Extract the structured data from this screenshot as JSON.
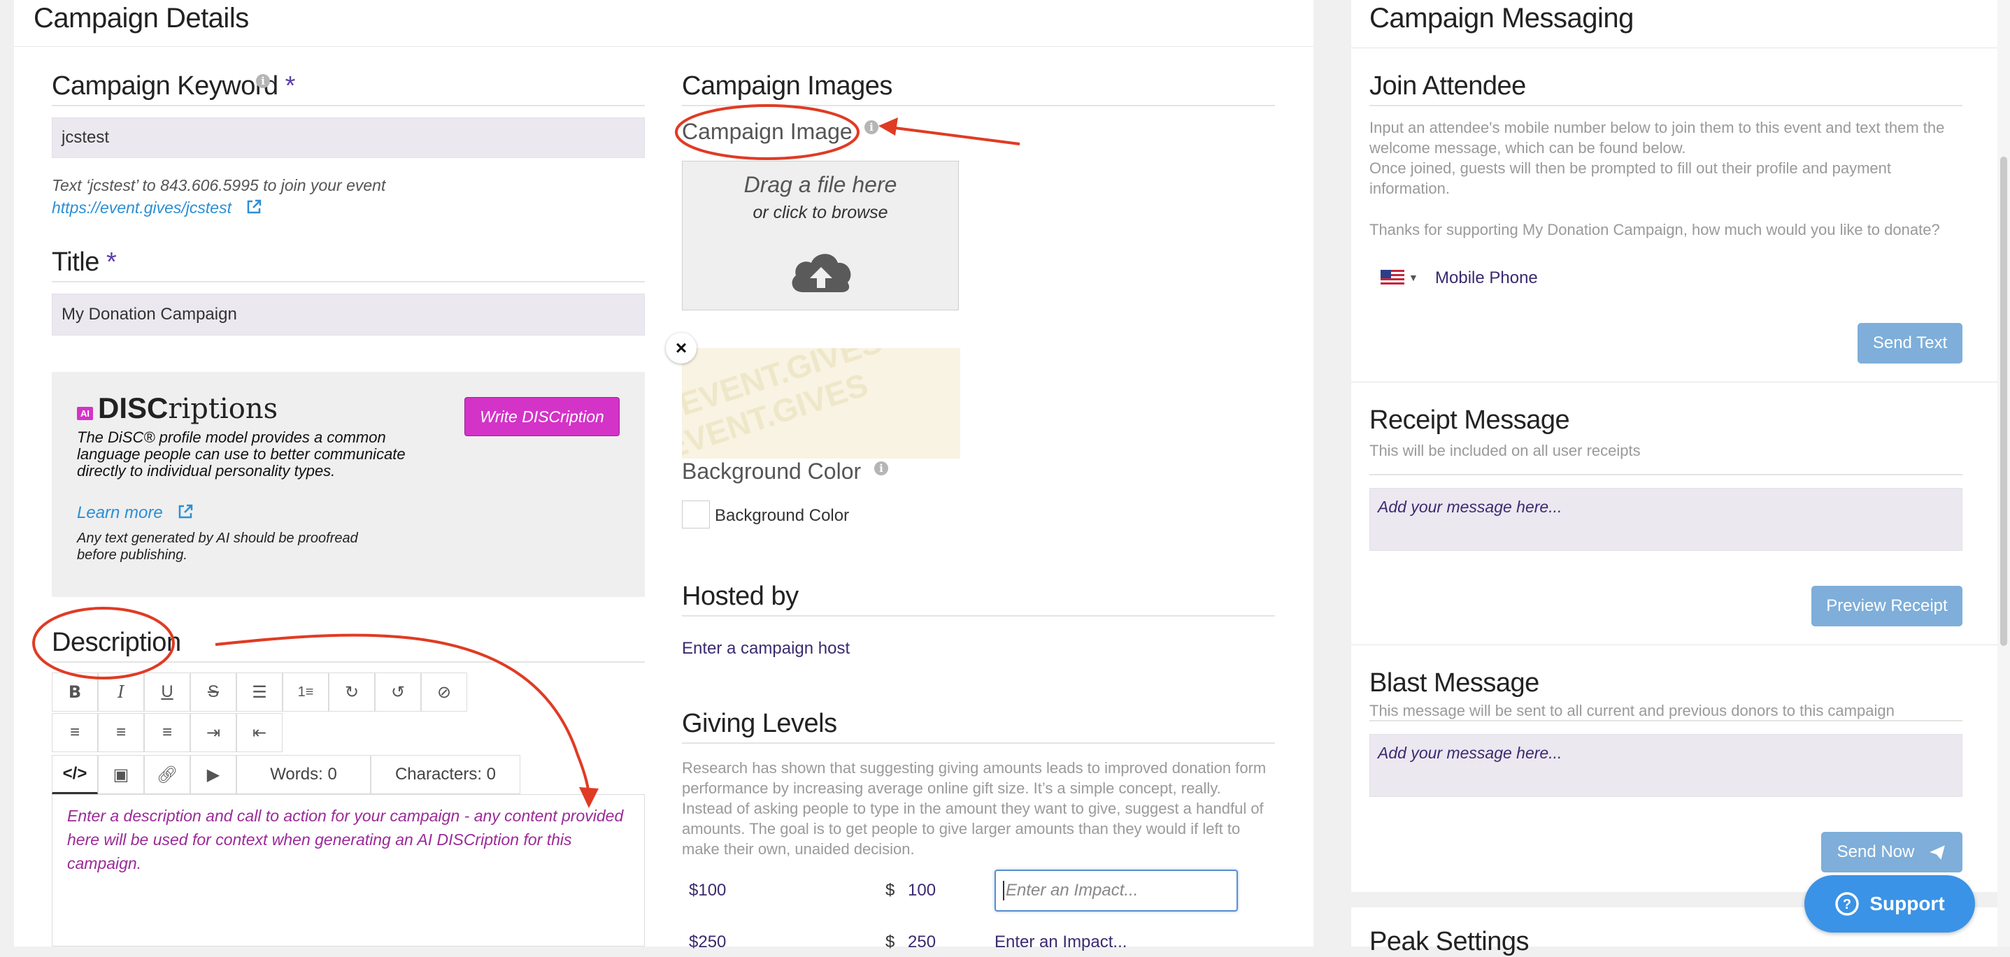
{
  "left_panel": {
    "title": "Campaign Details",
    "keyword": {
      "label": "Campaign Keyword",
      "required": "*",
      "value": "jcstest",
      "hint": "Text ‘jcstest’ to 843.606.5995 to join your event",
      "link": "https://event.gives/jcstest"
    },
    "title_field": {
      "label": "Title",
      "required": "*",
      "value": "My Donation Campaign"
    },
    "discriptions": {
      "ai_badge": "AI",
      "logo_bold": "DISC",
      "logo_light": "riptions",
      "description": "The DiSC® profile model provides a common language people can use to better communicate directly to individual personality types.",
      "learn_more": "Learn more",
      "disclaimer": "Any text generated by AI should be proofread before publishing.",
      "write_button": "Write DISCription"
    },
    "description": {
      "label": "Description",
      "words": "Words: 0",
      "characters": "Characters: 0",
      "placeholder": "Enter a description and call to action for your campaign - any content provided here will be used for context when generating an AI DISCription for this campaign.",
      "toolbar_icons": [
        "bold-icon",
        "italic-icon",
        "underline-icon",
        "strikethrough-icon",
        "bullet-list-icon",
        "numbered-list-icon",
        "redo-icon",
        "undo-icon",
        "clear-format-icon",
        "align-left-icon",
        "align-center-icon",
        "align-right-icon",
        "indent-icon",
        "outdent-icon",
        "code-view-icon",
        "image-icon",
        "link-icon",
        "video-icon"
      ]
    },
    "images": {
      "section": "Campaign Images",
      "image_label": "Campaign Image",
      "drop_line1": "Drag a file here",
      "drop_line2": "or click to browse",
      "watermark": "EVENT.GIVES",
      "bg_label": "Background Color",
      "bg_checkbox": "Background Color"
    },
    "hosted_by": {
      "section": "Hosted by",
      "placeholder": "Enter a campaign host"
    },
    "giving_levels": {
      "section": "Giving Levels",
      "description": "Research has shown that suggesting giving amounts leads to improved donation form performance by increasing average online gift size. It’s a simple concept, really. Instead of asking people to type in the amount they want to give, suggest a handful of amounts. The goal is to get people to give larger amounts than they would if left to make their own, unaided decision.",
      "levels": [
        {
          "label": "$100",
          "currency": "$",
          "amount": "100",
          "impact_placeholder": "Enter an Impact..."
        },
        {
          "label": "$250",
          "currency": "$",
          "amount": "250",
          "impact_placeholder": "Enter an Impact..."
        }
      ]
    }
  },
  "right_panel": {
    "title": "Campaign Messaging",
    "join": {
      "section": "Join Attendee",
      "text1": "Input an attendee's mobile number below to join them to this event and text them the welcome message, which can be found below.",
      "text2": "Once joined, guests will then be prompted to fill out their profile and payment information.",
      "text3": "Thanks for supporting My Donation Campaign, how much would you like to donate?",
      "phone_placeholder": "Mobile Phone",
      "send_button": "Send Text"
    },
    "receipt": {
      "section": "Receipt Message",
      "sub": "This will be included on all user receipts",
      "placeholder": "Add your message here...",
      "button": "Preview Receipt"
    },
    "blast": {
      "section": "Blast Message",
      "sub": "This message will be sent to all current and previous donors to this campaign",
      "placeholder": "Add your message here...",
      "button": "Send Now"
    },
    "next_section": "Peak Settings"
  },
  "support_button": "Support",
  "colors": {
    "accent_purple": "#d433c8",
    "link_blue": "#2b8fd6",
    "annotation_red": "#e03b24",
    "button_blue": "#7eaed9"
  }
}
